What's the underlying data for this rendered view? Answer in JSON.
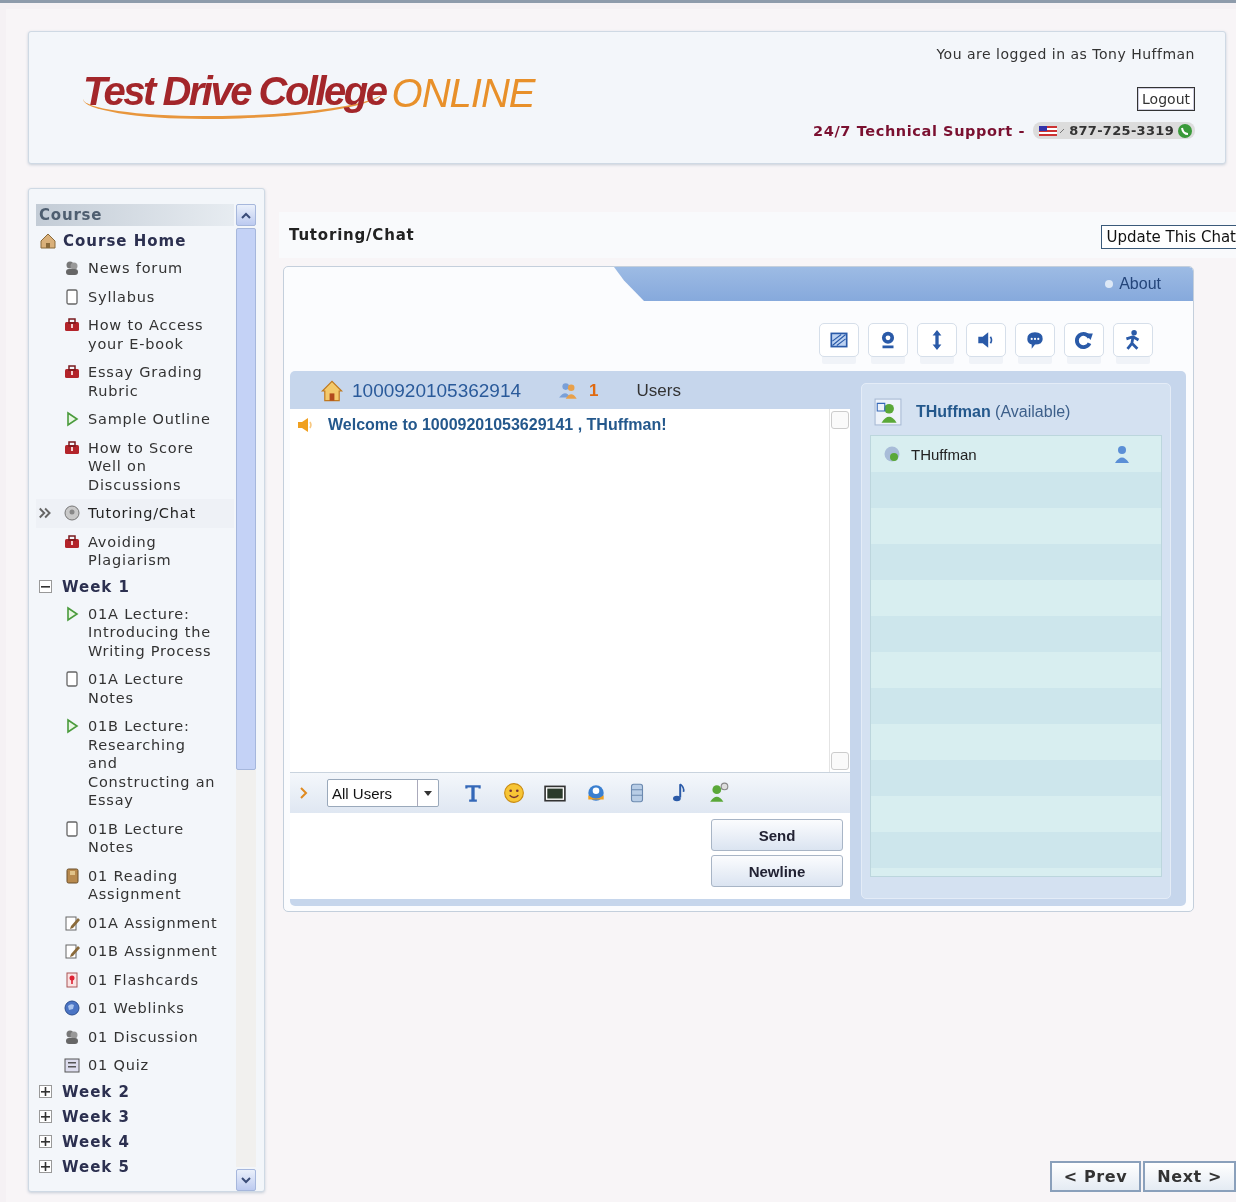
{
  "header": {
    "logo_main": "Test Drive College",
    "logo_accent": "ONLINE",
    "login_text": "You are logged in as Tony Huffman",
    "logout_button": "Logout",
    "support_label": "24/7 Technical Support -",
    "phone": "877-725-3319"
  },
  "sidebar": {
    "title": "Course",
    "items": [
      {
        "label": "Course Home",
        "kind": "home",
        "children": [
          {
            "label": "News forum",
            "kind": "forum",
            "current": false
          },
          {
            "label": "Syllabus",
            "kind": "page",
            "current": false
          },
          {
            "label": "How to Access your E-book",
            "kind": "kit",
            "current": false
          },
          {
            "label": "Essay Grading Rubric",
            "kind": "kit",
            "current": false
          },
          {
            "label": "Sample Outline",
            "kind": "lecture",
            "current": false
          },
          {
            "label": "How to Score Well on Discussions",
            "kind": "kit",
            "current": false
          },
          {
            "label": "Tutoring/Chat",
            "kind": "chat",
            "current": true
          },
          {
            "label": "Avoiding Plagiarism",
            "kind": "kit",
            "current": false
          }
        ]
      },
      {
        "label": "Week 1",
        "kind": "week",
        "expanded": true,
        "children": [
          {
            "label": "01A Lecture: Introducing the Writing Process",
            "kind": "lecture",
            "current": false
          },
          {
            "label": "01A Lecture Notes",
            "kind": "page",
            "current": false
          },
          {
            "label": "01B Lecture: Researching and Constructing an Essay",
            "kind": "lecture",
            "current": false
          },
          {
            "label": "01B Lecture Notes",
            "kind": "page",
            "current": false
          },
          {
            "label": "01 Reading Assignment",
            "kind": "book",
            "current": false
          },
          {
            "label": "01A Assignment",
            "kind": "assignment",
            "current": false
          },
          {
            "label": "01B Assignment",
            "kind": "assignment",
            "current": false
          },
          {
            "label": "01 Flashcards",
            "kind": "flashcard",
            "current": false
          },
          {
            "label": "01 Weblinks",
            "kind": "weblink",
            "current": false
          },
          {
            "label": "01 Discussion",
            "kind": "forum",
            "current": false
          },
          {
            "label": "01 Quiz",
            "kind": "quiz",
            "current": false
          }
        ]
      },
      {
        "label": "Week 2",
        "kind": "week",
        "expanded": false
      },
      {
        "label": "Week 3",
        "kind": "week",
        "expanded": false
      },
      {
        "label": "Week 4",
        "kind": "week",
        "expanded": false
      },
      {
        "label": "Week 5",
        "kind": "week",
        "expanded": false
      }
    ]
  },
  "page_title": "Tutoring/Chat",
  "update_button": "Update This Chat",
  "chat": {
    "about_link": "About",
    "toolbar": [
      {
        "kind": "whiteboard"
      },
      {
        "kind": "webcam"
      },
      {
        "kind": "resize"
      },
      {
        "kind": "sound"
      },
      {
        "kind": "bubble"
      },
      {
        "kind": "refresh"
      },
      {
        "kind": "exit"
      }
    ],
    "room": "1000920105362914",
    "user_count": "1",
    "users_label": "Users",
    "messages": [
      {
        "text": "Welcome to 10009201053629141 , THuffman!"
      }
    ],
    "recipient": "All Users",
    "compose_tools": [
      {
        "kind": "font"
      },
      {
        "kind": "smiley"
      },
      {
        "kind": "image"
      },
      {
        "kind": "app"
      },
      {
        "kind": "database"
      },
      {
        "kind": "music"
      },
      {
        "kind": "adduser"
      }
    ],
    "send_button": "Send",
    "newline_button": "Newline",
    "self_name": "THuffman",
    "self_status": "(Available)",
    "users": [
      {
        "name": "THuffman"
      }
    ]
  },
  "nav": {
    "prev": "< Prev",
    "next": "Next >"
  }
}
